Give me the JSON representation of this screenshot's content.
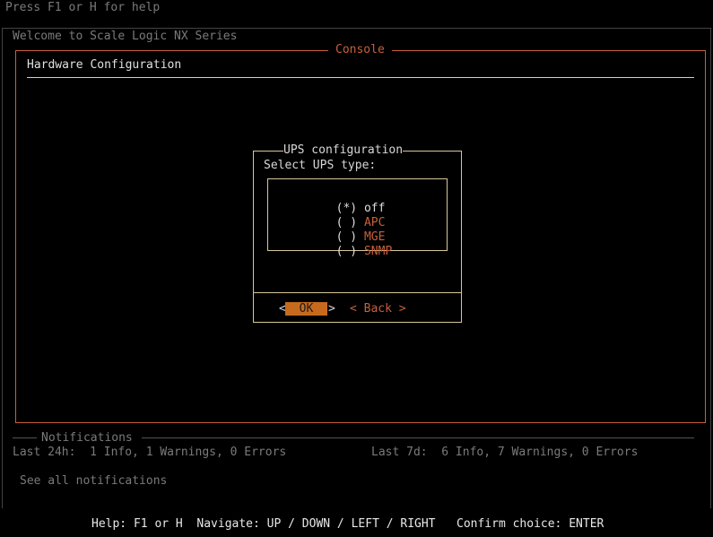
{
  "top_hint": "Press F1 or H for help",
  "welcome": "Welcome to Scale Logic NX Series",
  "console": {
    "title": "Console",
    "section_heading": "Hardware Configuration"
  },
  "dialog": {
    "title": "UPS configuration",
    "prompt": "Select UPS type:",
    "options": [
      {
        "mark": "(*)",
        "label": "off"
      },
      {
        "mark": "( )",
        "label": "APC"
      },
      {
        "mark": "( )",
        "label": "MGE"
      },
      {
        "mark": "( )",
        "label": "SNMP"
      }
    ],
    "ok_label": "OK",
    "back_label": "< Back >"
  },
  "notifications": {
    "title": "Notifications",
    "last_24h": "Last 24h:  1 Info, 1 Warnings, 0 Errors",
    "last_7d": "Last 7d:  6 Info, 7 Warnings, 0 Errors",
    "see_all": "See all notifications"
  },
  "help_bar": "Help: F1 or H  Navigate: UP / DOWN / LEFT / RIGHT   Confirm choice: ENTER",
  "colors": {
    "accent": "#c8603a",
    "button_fill": "#c86a1e",
    "dialog_border": "#d8c79b"
  }
}
